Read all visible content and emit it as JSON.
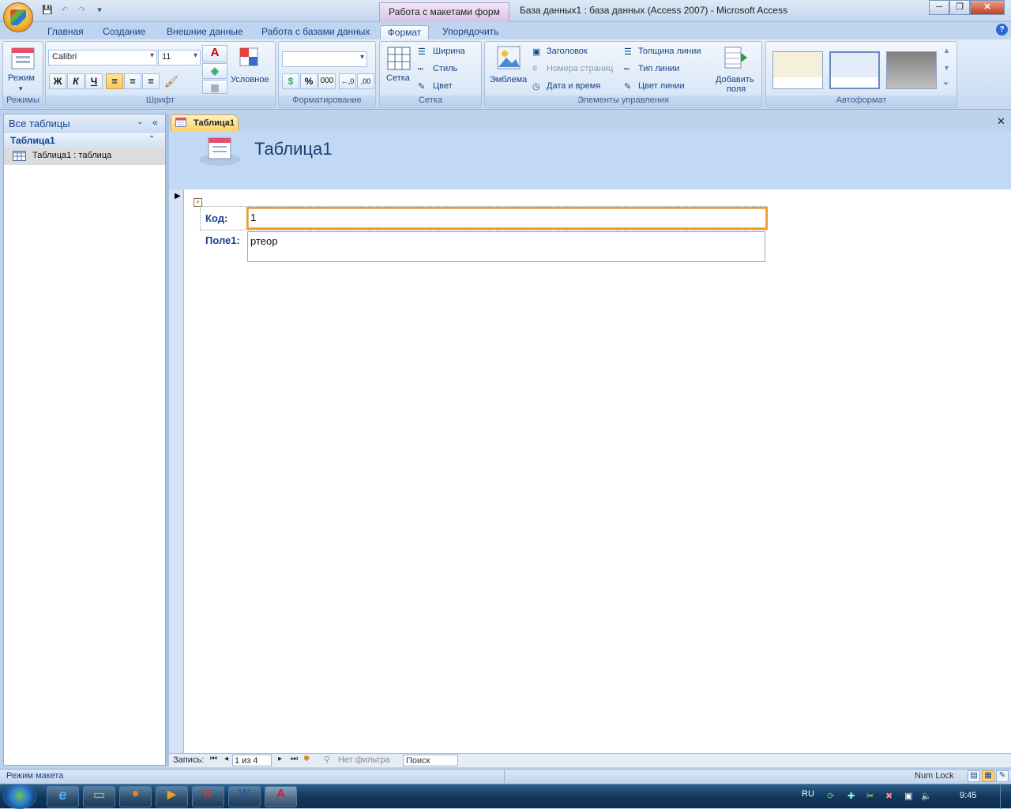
{
  "window": {
    "contextual_tab": "Работа с макетами форм",
    "title": "База данных1 : база данных (Access 2007) - Microsoft Access",
    "min": "─",
    "max": "❐",
    "close": "✕"
  },
  "ribbon_tabs": [
    "Главная",
    "Создание",
    "Внешние данные",
    "Работа с базами данных",
    "Формат",
    "Упорядочить"
  ],
  "help": "?",
  "groups": {
    "modes": {
      "label": "Режимы",
      "view": "Режим"
    },
    "font": {
      "label": "Шрифт",
      "font_name": "Calibri",
      "font_size": "11",
      "bold": "Ж",
      "italic": "К",
      "underline": "Ч",
      "conditional": "Условное"
    },
    "formatting": {
      "label": "Форматирование",
      "format_value": "",
      "percent": "%",
      "thousands": "000",
      "inc_dec": "←,0",
      "dec_dec": ",00"
    },
    "grid": {
      "label": "Сетка",
      "grid": "Сетка",
      "width": "Ширина",
      "style": "Стиль",
      "color": "Цвет"
    },
    "controls": {
      "label": "Элементы управления",
      "logo": "Эмблема",
      "title": "Заголовок",
      "page_numbers": "Номера страниц",
      "date_time": "Дата и время",
      "line_thickness": "Толщина линии",
      "line_type": "Тип линии",
      "line_color": "Цвет линии",
      "add_fields_1": "Добавить",
      "add_fields_2": "поля"
    },
    "autoformat": {
      "label": "Автоформат"
    }
  },
  "nav": {
    "header": "Все таблицы",
    "group": "Таблица1",
    "item": "Таблица1 : таблица"
  },
  "document": {
    "tab": "Таблица1",
    "form_title": "Таблица1"
  },
  "form": {
    "fields": [
      {
        "label": "Код:",
        "value": "1"
      },
      {
        "label": "Поле1:",
        "value": "ртеор"
      }
    ]
  },
  "record_nav": {
    "label": "Запись:",
    "position": "1 из 4",
    "filter": "Нет фильтра",
    "search": "Поиск"
  },
  "status": {
    "mode": "Режим макета",
    "numlock": "Num Lock"
  },
  "taskbar": {
    "lang": "RU",
    "time": "9:45"
  }
}
